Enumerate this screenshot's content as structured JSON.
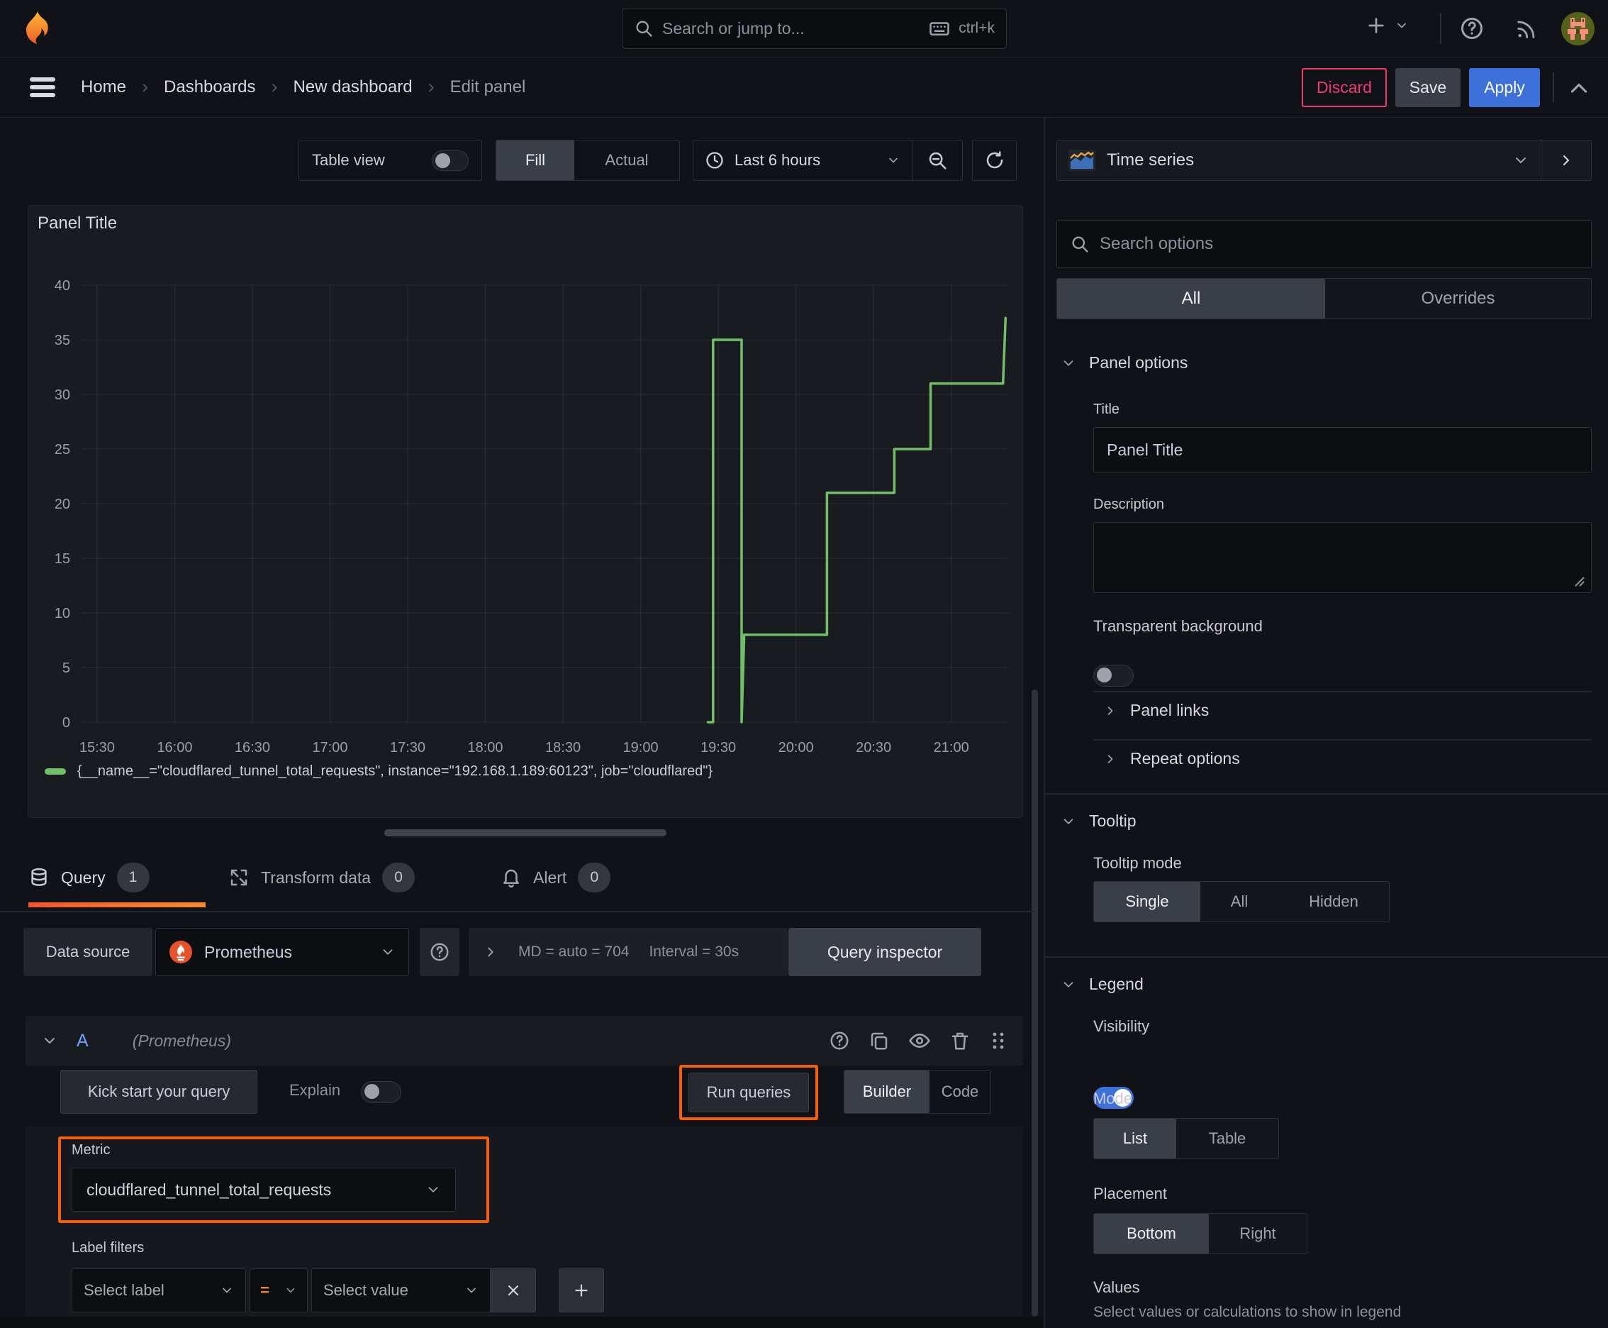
{
  "topbar": {
    "search_placeholder": "Search or jump to...",
    "search_shortcut": "ctrl+k"
  },
  "breadcrumb": {
    "items": [
      "Home",
      "Dashboards",
      "New dashboard",
      "Edit panel"
    ]
  },
  "header_actions": {
    "discard": "Discard",
    "save": "Save",
    "apply": "Apply"
  },
  "view_controls": {
    "table_view": "Table view",
    "fill": "Fill",
    "actual": "Actual",
    "time_range": "Last 6 hours"
  },
  "panel": {
    "title": "Panel Title"
  },
  "chart_data": {
    "type": "line",
    "title": "Panel Title",
    "xlabel": "",
    "ylabel": "",
    "ylim": [
      0,
      40
    ],
    "y_ticks": [
      0,
      5,
      10,
      15,
      20,
      25,
      30,
      35,
      40
    ],
    "x_ticks": [
      "15:30",
      "16:00",
      "16:30",
      "17:00",
      "17:30",
      "18:00",
      "18:30",
      "19:00",
      "19:30",
      "20:00",
      "20:30",
      "21:00"
    ],
    "x_window": [
      "15:24",
      "21:22"
    ],
    "grid": true,
    "legend_position": "bottom",
    "series": [
      {
        "name": "{__name__=\"cloudflared_tunnel_total_requests\", instance=\"192.168.1.189:60123\", job=\"cloudflared\"}",
        "color": "#73bf69",
        "points": [
          [
            "19:26",
            0
          ],
          [
            "19:28",
            0
          ],
          [
            "19:28",
            35
          ],
          [
            "19:39",
            35
          ],
          [
            "19:39",
            0
          ],
          [
            "19:40",
            8
          ],
          [
            "20:12",
            8
          ],
          [
            "20:12",
            21
          ],
          [
            "20:38",
            21
          ],
          [
            "20:38",
            25
          ],
          [
            "20:52",
            25
          ],
          [
            "20:52",
            31
          ],
          [
            "21:20",
            31
          ],
          [
            "21:21",
            37
          ]
        ]
      }
    ]
  },
  "query_tabs": [
    {
      "label": "Query",
      "count": "1"
    },
    {
      "label": "Transform data",
      "count": "0"
    },
    {
      "label": "Alert",
      "count": "0"
    }
  ],
  "datasource_row": {
    "label": "Data source",
    "value": "Prometheus",
    "md_stat": "MD = auto = 704",
    "interval_stat": "Interval = 30s",
    "inspector": "Query inspector"
  },
  "query_editor": {
    "ref_id": "A",
    "datasource_hint": "(Prometheus)",
    "kick_start": "Kick start your query",
    "explain": "Explain",
    "run_queries": "Run queries",
    "builder": "Builder",
    "code": "Code",
    "metric": {
      "label": "Metric",
      "value": "cloudflared_tunnel_total_requests"
    },
    "label_filters": {
      "label": "Label filters",
      "select_label": "Select label",
      "operator": "=",
      "select_value": "Select value"
    }
  },
  "options_pane": {
    "visualization": "Time series",
    "search_placeholder": "Search options",
    "tab_all": "All",
    "tab_overrides": "Overrides",
    "panel_options": {
      "title": "Panel options",
      "title_label": "Title",
      "title_value": "Panel Title",
      "description_label": "Description",
      "transparent_label": "Transparent background"
    },
    "panel_links": "Panel links",
    "repeat_options": "Repeat options",
    "tooltip": {
      "title": "Tooltip",
      "mode_label": "Tooltip mode",
      "modes": [
        "Single",
        "All",
        "Hidden"
      ],
      "selected": "Single"
    },
    "legend": {
      "title": "Legend",
      "visibility_label": "Visibility",
      "mode_label": "Mode",
      "modes": [
        "List",
        "Table"
      ],
      "selected_mode": "List",
      "placement_label": "Placement",
      "placements": [
        "Bottom",
        "Right"
      ],
      "selected_placement": "Bottom",
      "values_label": "Values",
      "values_description": "Select values or calculations to show in legend"
    }
  },
  "colors": {
    "accent_blue": "#3d71d9",
    "highlight_orange": "#f55f0c",
    "discard_pink": "#f23a70",
    "series_green": "#73bf69",
    "prometheus_orange": "#e6522c"
  }
}
